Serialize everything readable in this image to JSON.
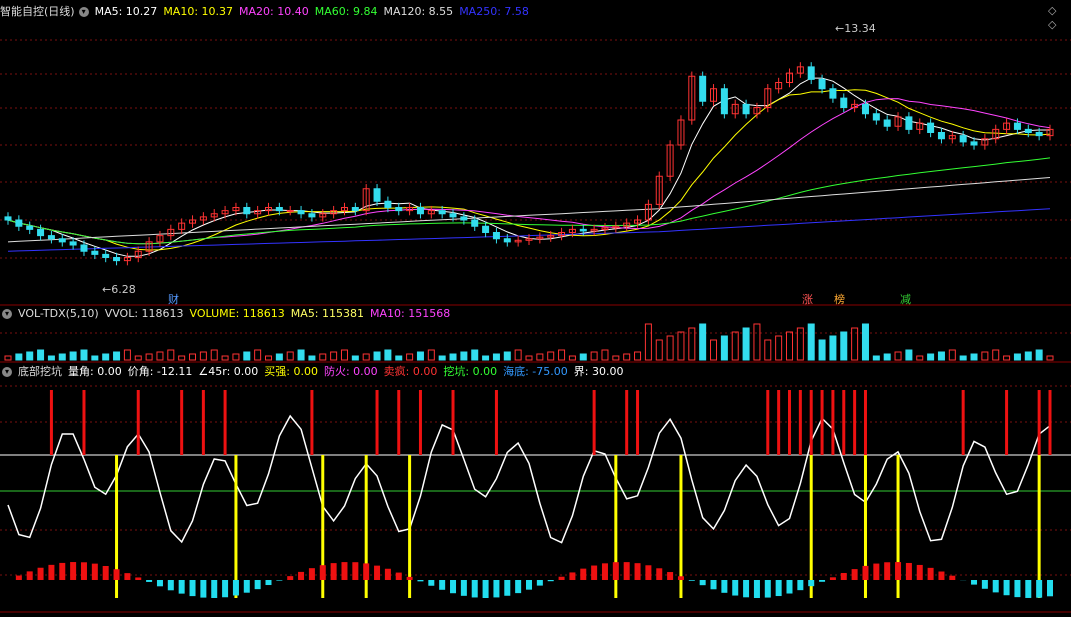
{
  "main_panel": {
    "title": "智能自控(日线)",
    "indicators": [
      {
        "label": "MA5: 10.27",
        "color": "#ffffff"
      },
      {
        "label": "MA10: 10.37",
        "color": "#ffff00"
      },
      {
        "label": "MA20: 10.40",
        "color": "#ff44ff"
      },
      {
        "label": "MA60: 9.84",
        "color": "#33ff33"
      },
      {
        "label": "MA120: 8.55",
        "color": "#dddddd"
      },
      {
        "label": "MA250: 7.58",
        "color": "#3333ff"
      }
    ],
    "high_label": "13.34",
    "low_label": "6.28",
    "event_tags": [
      {
        "text": "财",
        "color": "#5599ff"
      },
      {
        "text": "涨",
        "color": "#ff5555"
      },
      {
        "text": "榜",
        "color": "#ffaa33"
      },
      {
        "text": "减",
        "color": "#33cc33"
      }
    ]
  },
  "volume_panel": {
    "title": "VOL-TDX(5,10)",
    "indicators": [
      {
        "label": "VVOL: 118613",
        "color": "#dddddd"
      },
      {
        "label": "VOLUME: 118613",
        "color": "#ffff00"
      },
      {
        "label": "MA5: 115381",
        "color": "#ffff66"
      },
      {
        "label": "MA10: 151568",
        "color": "#ff44ff"
      }
    ]
  },
  "bottom_panel": {
    "title": "底部挖坑",
    "indicators": [
      {
        "label": "量角: 0.00",
        "color": "#ffffff"
      },
      {
        "label": "价角: -12.11",
        "color": "#ffffff"
      },
      {
        "label": "∠45r: 0.00",
        "color": "#ffffff"
      },
      {
        "label": "买强: 0.00",
        "color": "#ffff00"
      },
      {
        "label": "防火: 0.00",
        "color": "#ff44ff"
      },
      {
        "label": "卖疯: 0.00",
        "color": "#ff3333"
      },
      {
        "label": "挖坑: 0.00",
        "color": "#33ff33"
      },
      {
        "label": "海底: -75.00",
        "color": "#3399ff"
      },
      {
        "label": "界: 30.00",
        "color": "#ffffff"
      }
    ]
  },
  "chart_data": {
    "type": "candlestick",
    "closes": [
      7.6,
      7.4,
      7.3,
      7.1,
      7.0,
      6.9,
      6.8,
      6.6,
      6.5,
      6.4,
      6.3,
      6.4,
      6.6,
      6.9,
      7.1,
      7.3,
      7.5,
      7.6,
      7.7,
      7.8,
      7.9,
      8.0,
      7.8,
      7.9,
      8.0,
      7.9,
      7.9,
      7.8,
      7.7,
      7.8,
      7.9,
      8.0,
      7.9,
      8.6,
      8.2,
      8.0,
      7.9,
      8.0,
      7.8,
      7.9,
      7.8,
      7.7,
      7.6,
      7.4,
      7.2,
      7.0,
      6.9,
      6.95,
      7.0,
      7.05,
      7.1,
      7.2,
      7.3,
      7.25,
      7.3,
      7.35,
      7.4,
      7.5,
      7.6,
      8.1,
      9.0,
      10.0,
      10.8,
      12.2,
      11.4,
      11.8,
      11.0,
      11.3,
      11.0,
      11.2,
      11.8,
      12.0,
      12.3,
      12.5,
      12.1,
      11.8,
      11.5,
      11.2,
      11.3,
      11.0,
      10.8,
      10.6,
      10.9,
      10.5,
      10.7,
      10.4,
      10.2,
      10.3,
      10.1,
      10.0,
      10.2,
      10.5,
      10.7,
      10.5,
      10.4,
      10.3,
      10.5
    ],
    "y_range": [
      6.0,
      14.0
    ],
    "high": 13.34,
    "low": 6.28
  }
}
